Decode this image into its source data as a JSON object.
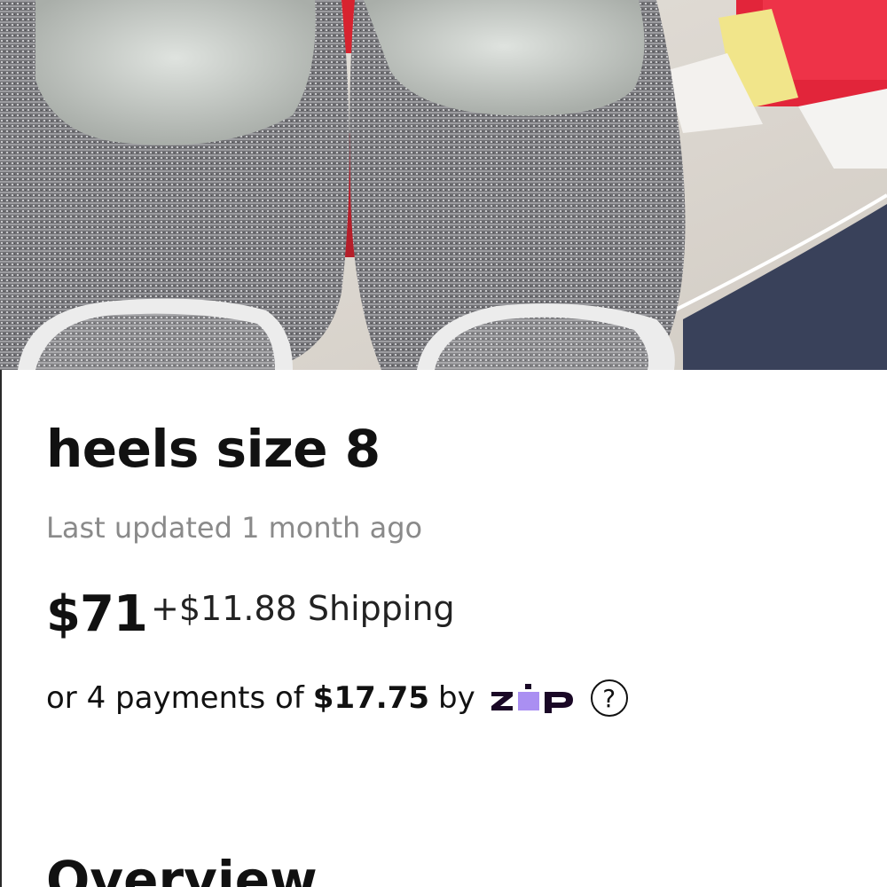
{
  "listing": {
    "title": "heels size 8",
    "updated": "Last updated 1 month ago",
    "price": "$71",
    "shipping": "+$11.88 Shipping",
    "installments": {
      "prefix": "or 4 payments of",
      "amount": "$17.75",
      "suffix": "by",
      "provider": "zip"
    },
    "help_icon": "question-circle-icon"
  },
  "overview": {
    "heading": "Overview"
  },
  "colors": {
    "zip_purple": "#aa8ff2",
    "zip_navy": "#1a0826",
    "text": "#111111",
    "muted": "#8a8a8a"
  }
}
